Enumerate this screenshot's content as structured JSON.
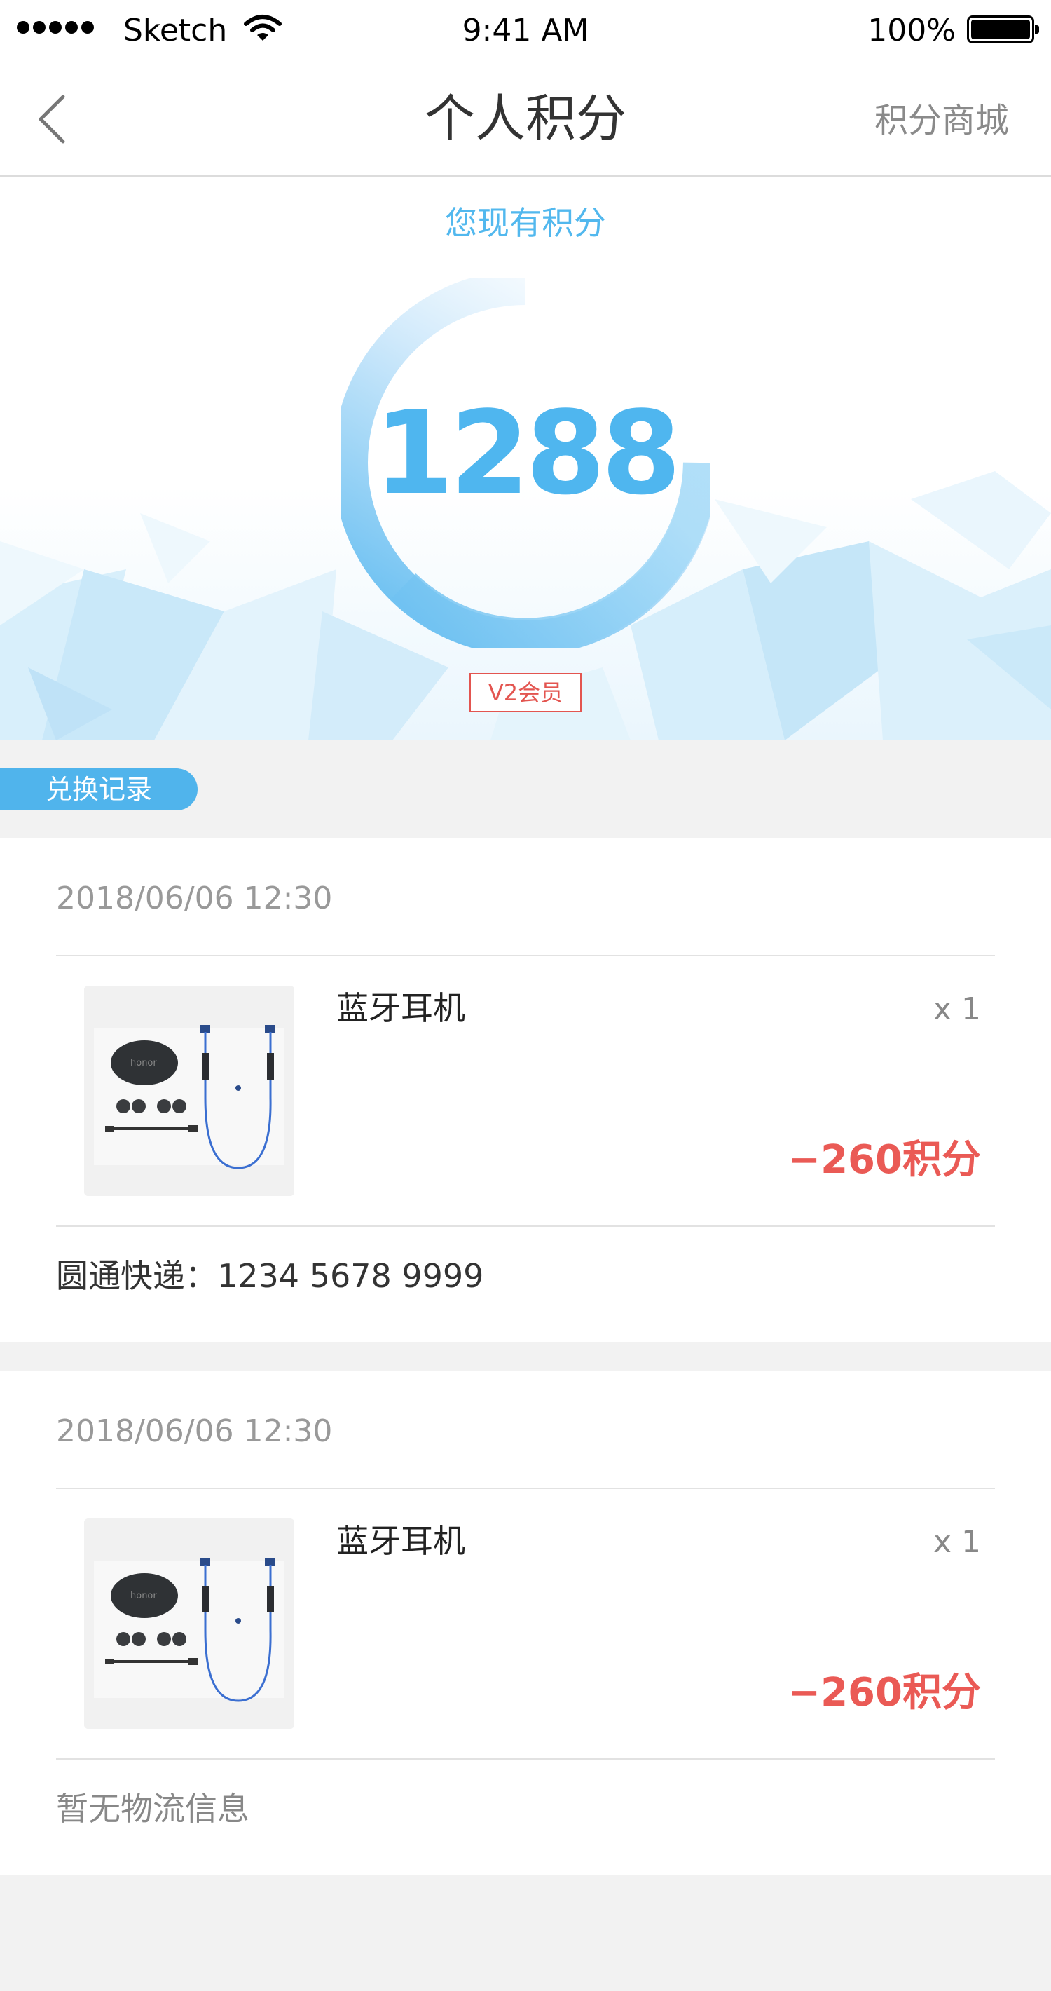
{
  "status_bar": {
    "carrier": "Sketch",
    "time": "9:41 AM",
    "battery": "100%"
  },
  "nav": {
    "title": "个人积分",
    "right_link": "积分商城",
    "back_icon": "chevron-left-icon"
  },
  "points": {
    "label": "您现有积分",
    "value": "1288",
    "member_level": "V2会员",
    "accent_color": "#4fb6ef"
  },
  "section": {
    "tag": "兑换记录"
  },
  "records": [
    {
      "time": "2018/06/06 12:30",
      "item_name": "蓝牙耳机",
      "quantity": "x 1",
      "points": "−260积分",
      "logistics": "圆通快递：1234 5678 9999"
    },
    {
      "time": "2018/06/06 12:30",
      "item_name": "蓝牙耳机",
      "quantity": "x 1",
      "points": "−260积分",
      "logistics": "暂无物流信息"
    }
  ],
  "colors": {
    "points_negative": "#ea5a55",
    "badge": "#e35550"
  }
}
